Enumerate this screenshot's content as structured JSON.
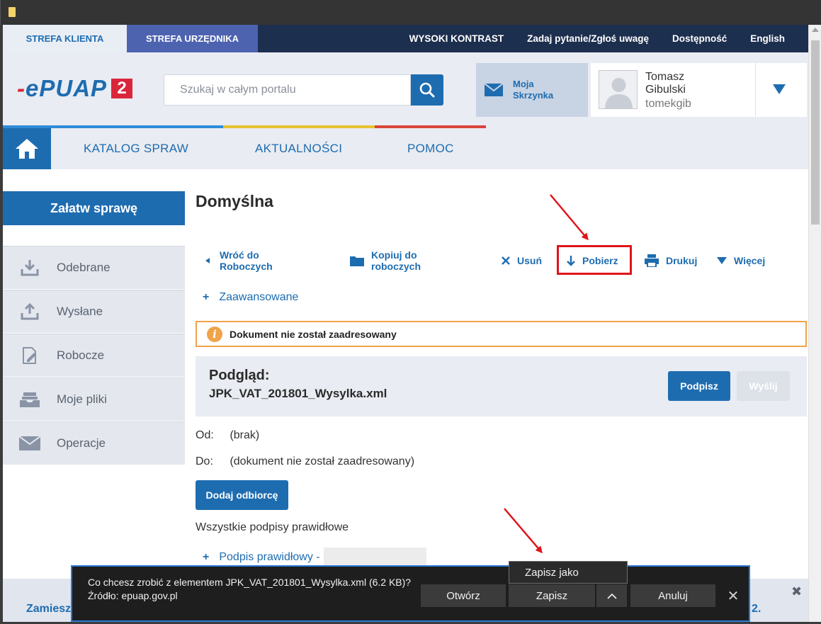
{
  "top_tabs": {
    "klienta": "STREFA KLIENTA",
    "urzednika": "STREFA URZĘDNIKA"
  },
  "top_links": [
    "WYSOKI KONTRAST",
    "Zadaj pytanie/Zgłoś uwagę",
    "Dostępność",
    "English"
  ],
  "header": {
    "logo_text": "ePUAP",
    "logo_num": "2",
    "search_placeholder": "Szukaj w całym portalu",
    "mailbox_label": "Moja Skrzynka",
    "user_name": "Tomasz Gibulski",
    "user_login": "tomekgib"
  },
  "nav": {
    "items": [
      "KATALOG SPRAW",
      "AKTUALNOŚCI",
      "POMOC"
    ],
    "bar_colors": [
      "#2f8ad8",
      "#e6c230",
      "#d9453b"
    ]
  },
  "sidebar": {
    "cta": "Załatw sprawę",
    "items": [
      {
        "label": "Odebrane",
        "icon": "inbox-download-icon"
      },
      {
        "label": "Wysłane",
        "icon": "outbox-upload-icon"
      },
      {
        "label": "Robocze",
        "icon": "draft-edit-icon"
      },
      {
        "label": "Moje pliki",
        "icon": "files-tray-icon"
      },
      {
        "label": "Operacje",
        "icon": "envelope-icon"
      }
    ]
  },
  "main": {
    "title": "Domyślna",
    "toolbar": {
      "back": "Wróć do Roboczych",
      "copy": "Kopiuj do roboczych",
      "delete": "Usuń",
      "download": "Pobierz",
      "print": "Drukuj",
      "more": "Więcej"
    },
    "advanced": "Zaawansowane",
    "alert": "Dokument nie został zaadresowany",
    "preview_heading": "Podgląd:",
    "preview_file": "JPK_VAT_201801_Wysylka.xml",
    "btn_sign": "Podpisz",
    "btn_send": "Wyślij",
    "from_label": "Od:",
    "from_value": "(brak)",
    "to_label": "Do:",
    "to_value": "(dokument nie został zaadresowany)",
    "btn_add_recipient": "Dodaj odbiorcę",
    "signatures_all": "Wszystkie podpisy prawidłowe",
    "signature_item": "Podpis prawidłowy -"
  },
  "footer": {
    "left": "Zamiesz",
    "right": "2."
  },
  "download_bar": {
    "message": "Co chcesz zrobić z elementem JPK_VAT_201801_Wysylka.xml (6.2 KB)?",
    "source": "Źródło: epuap.gov.pl",
    "open": "Otwórz",
    "save": "Zapisz",
    "cancel": "Anuluj",
    "save_as": "Zapisz jako"
  }
}
